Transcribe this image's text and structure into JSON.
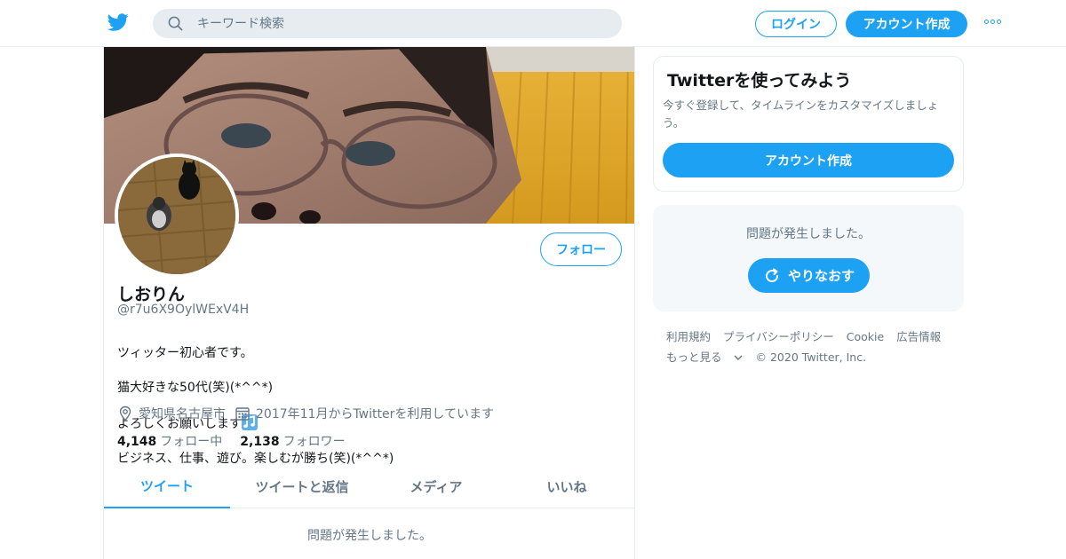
{
  "topbar": {
    "search_placeholder": "キーワード検索",
    "login_label": "ログイン",
    "signup_label": "アカウント作成"
  },
  "profile": {
    "display_name": "しおりん",
    "handle": "@r7u6X9OylWExV4H",
    "bio_line1": "ツィッター初心者です。",
    "bio_line2": "猫大好きな50代(笑)(*^^*)",
    "bio_line3": "よろしくお願いします",
    "bio_line4": "ビジネス、仕事、遊び。楽しむが勝ち(笑)(*^^*)",
    "location": "愛知県名古屋市",
    "joined": "2017年11月からTwitterを利用しています",
    "following_count": "4,148",
    "following_label": "フォロー中",
    "followers_count": "2,138",
    "followers_label": "フォロワー",
    "follow_button": "フォロー"
  },
  "tabs": [
    {
      "label": "ツイート",
      "active": true
    },
    {
      "label": "ツイートと返信",
      "active": false
    },
    {
      "label": "メディア",
      "active": false
    },
    {
      "label": "いいね",
      "active": false
    }
  ],
  "main": {
    "error_text": "問題が発生しました。"
  },
  "sidebar": {
    "signup_card": {
      "title": "Twitterを使ってみよう",
      "description": "今すぐ登録して、タイムラインをカスタマイズしましょう。",
      "button": "アカウント作成"
    },
    "error_card": {
      "text": "問題が発生しました。",
      "retry_button": "やりなおす"
    }
  },
  "footer": {
    "links": [
      "利用規約",
      "プライバシーポリシー",
      "Cookie",
      "広告情報",
      "もっと見る"
    ],
    "copyright": "© 2020 Twitter, Inc."
  },
  "colors": {
    "accent": "#1da1f2",
    "muted_text": "#657786",
    "border": "#e6ecf0"
  },
  "icons": [
    "twitter-bird-icon",
    "search-icon",
    "more-icon",
    "location-pin-icon",
    "calendar-icon",
    "music-note-icon",
    "refresh-icon",
    "chevron-down-icon"
  ]
}
